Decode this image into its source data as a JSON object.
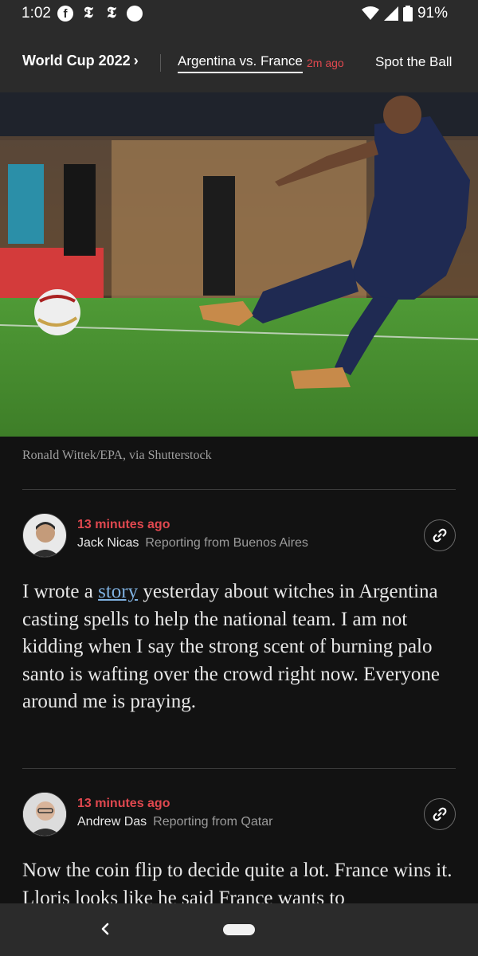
{
  "status": {
    "time": "1:02",
    "battery": "91%",
    "icons": [
      "facebook-icon",
      "nyt-icon",
      "nyt-icon",
      "circle-icon",
      "wifi-icon",
      "signal-icon",
      "battery-icon"
    ]
  },
  "nav": {
    "section": "World Cup 2022",
    "section_chevron": "›",
    "active_tab": "Argentina vs. France",
    "active_tab_time": "2m ago",
    "secondary_tab": "Spot the Ball"
  },
  "hero": {
    "caption": "Ronald Wittek/EPA, via Shutterstock"
  },
  "posts": [
    {
      "time": "13 minutes ago",
      "author": "Jack Nicas",
      "location": "Reporting from Buenos Aires",
      "body_before_link": "I wrote a ",
      "link_text": "story",
      "body_after_link": " yesterday about witches in Argentina casting spells to help the national team. I am not kidding when I say the strong scent of burning palo santo is wafting over the crowd right now. Everyone around me is praying."
    },
    {
      "time": "13 minutes ago",
      "author": "Andrew Das",
      "location": "Reporting from Qatar",
      "body": "Now the coin flip to decide quite a lot. France wins it. Lloris looks like he said France wants to"
    }
  ],
  "colors": {
    "accent_red": "#e0484f",
    "link_blue": "#7fb1e0",
    "background": "#121212",
    "bars": "#2b2b2b"
  }
}
